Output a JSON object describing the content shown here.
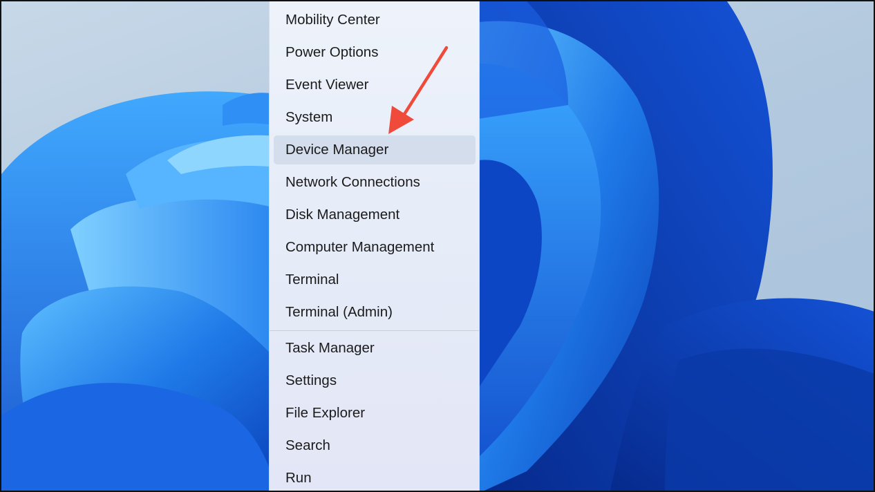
{
  "context_menu": {
    "items": [
      {
        "label": "Mobility Center"
      },
      {
        "label": "Power Options"
      },
      {
        "label": "Event Viewer"
      },
      {
        "label": "System"
      },
      {
        "label": "Device Manager",
        "highlighted": true
      },
      {
        "label": "Network Connections"
      },
      {
        "label": "Disk Management"
      },
      {
        "label": "Computer Management"
      },
      {
        "label": "Terminal"
      },
      {
        "label": "Terminal (Admin)"
      },
      {
        "label": "Task Manager"
      },
      {
        "label": "Settings"
      },
      {
        "label": "File Explorer"
      },
      {
        "label": "Search"
      },
      {
        "label": "Run"
      }
    ]
  },
  "annotation": {
    "arrow_color": "#f04a3a",
    "points_to": "Device Manager"
  },
  "colors": {
    "menu_background": "#eaf0fa",
    "highlight": "#d4ddec",
    "wallpaper_blue": "#1f6fe0"
  }
}
